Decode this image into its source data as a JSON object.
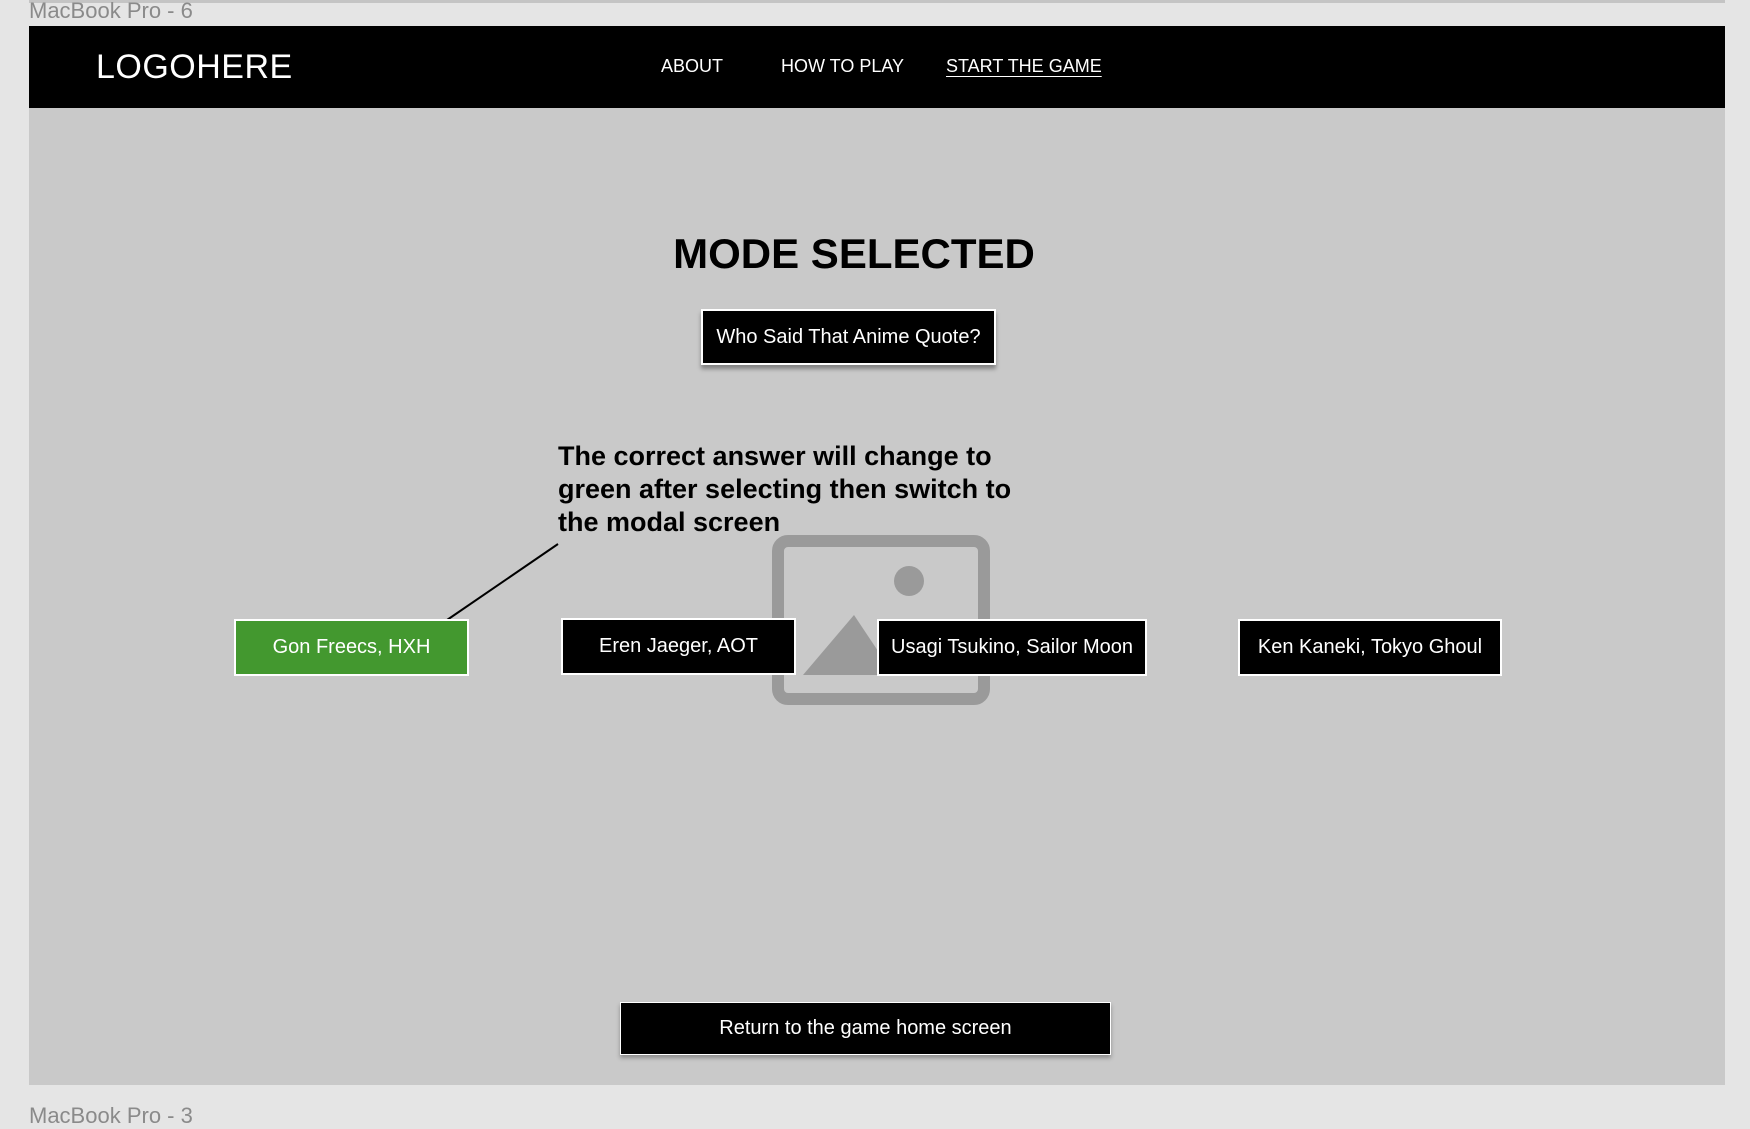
{
  "frame_labels": {
    "top": "MacBook Pro - 6",
    "bottom": "MacBook Pro - 3"
  },
  "header": {
    "logo": "LOGOHERE",
    "nav": [
      "ABOUT",
      "HOW TO PLAY",
      "START THE GAME"
    ],
    "active_nav": "START THE GAME"
  },
  "main": {
    "title": "MODE SELECTED",
    "mode_button": "Who Said That Anime Quote?",
    "annotation": "The correct answer will change to green after selecting then switch to the modal screen",
    "answers": [
      "Gon Freecs, HXH",
      "Eren Jaeger, AOT",
      "Usagi Tsukino, Sailor Moon",
      "Ken Kaneki, Tokyo Ghoul"
    ],
    "correct_answer_color": "#43982f",
    "return_button": "Return to the game home screen"
  },
  "placeholder_image_icon": "image-placeholder-icon"
}
